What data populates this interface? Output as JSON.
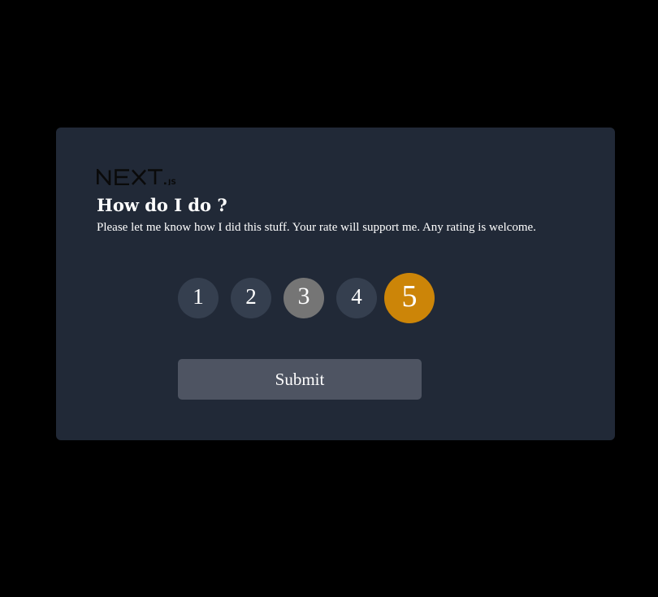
{
  "logo": {
    "text": "NEXT.js"
  },
  "title": "How do I do ?",
  "subtitle": "Please let me know how I did this stuff. Your rate will support me. Any rating is welcome.",
  "ratings": [
    "1",
    "2",
    "3",
    "4",
    "5"
  ],
  "selected_rating": "5",
  "hovered_rating": "3",
  "submit_label": "Submit",
  "colors": {
    "background": "#000000",
    "card": "#212937",
    "rating_default": "#353f4f",
    "rating_hover": "#757575",
    "rating_selected": "#cc8508",
    "submit_button": "#4e5462",
    "text": "#ffffff"
  }
}
